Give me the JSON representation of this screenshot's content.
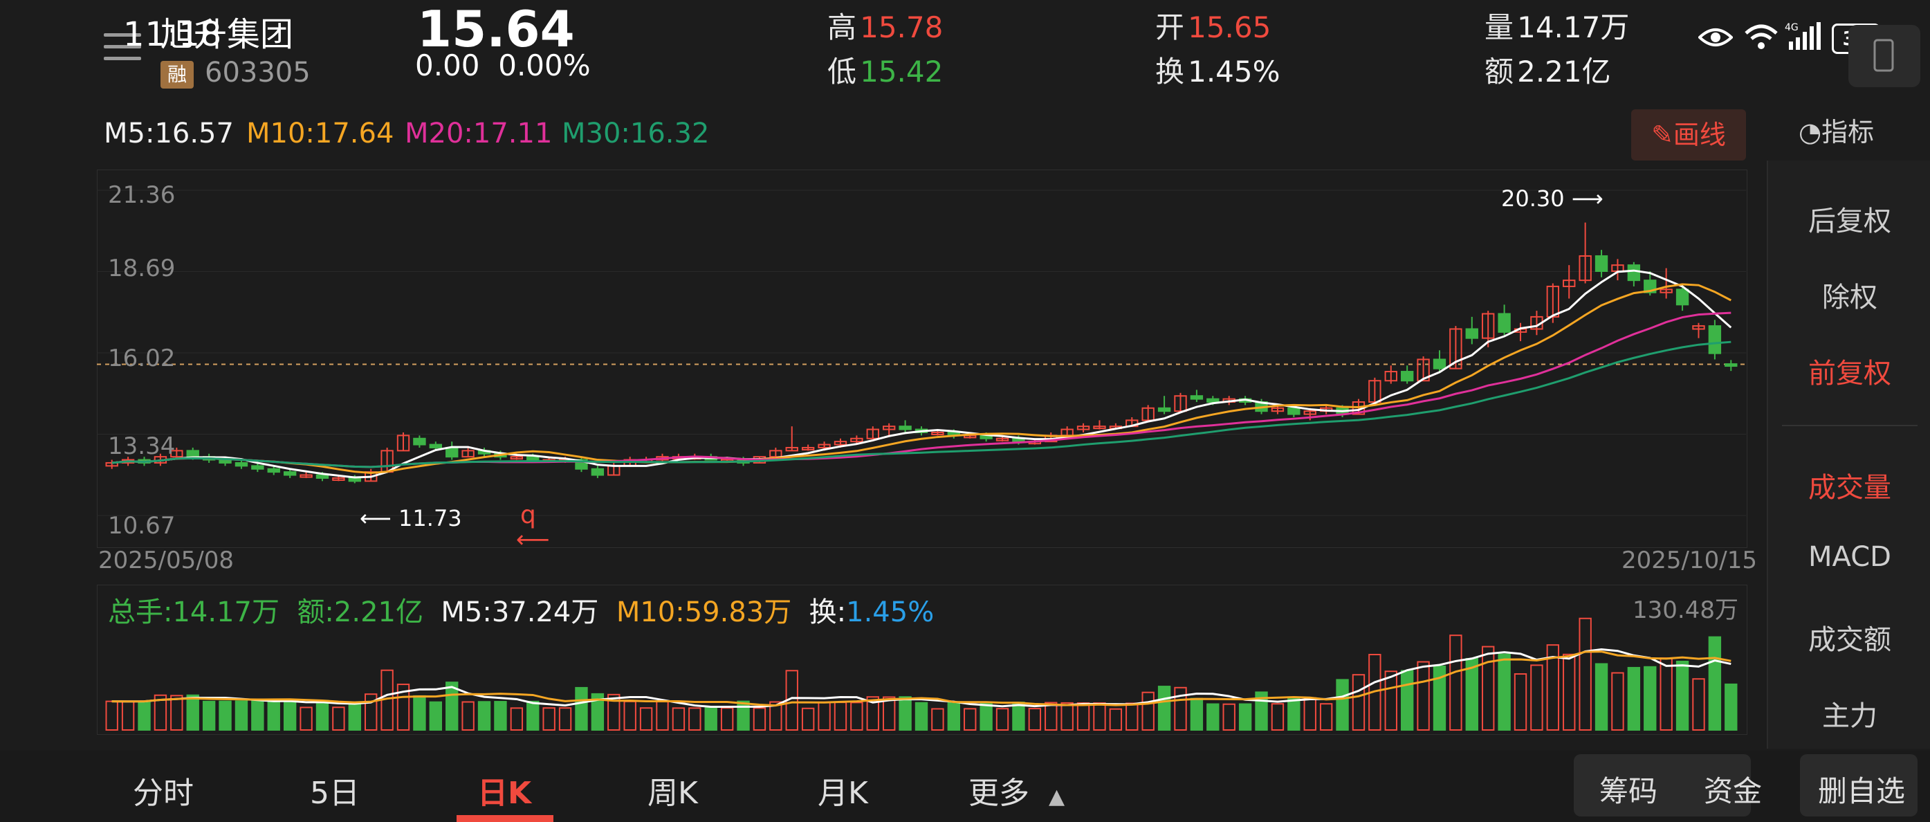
{
  "header": {
    "time": "11:18",
    "stock_name": "旭升集团",
    "rong_badge": "融",
    "code": "603305",
    "price": "15.64",
    "change": "0.00",
    "change_pct": "0.00%",
    "high_label": "高",
    "high": "15.78",
    "low_label": "低",
    "low": "15.42",
    "open_label": "开",
    "open": "15.65",
    "turnover_label": "换",
    "turnover": "1.45%",
    "volume_label": "量",
    "volume": "14.17万",
    "amount_label": "额",
    "amount": "2.21亿",
    "battery": "34"
  },
  "ma": {
    "m5": "M5:16.57",
    "m10": "M10:17.64",
    "m20": "M20:17.11",
    "m30": "M30:16.32"
  },
  "buttons": {
    "draw": "画线",
    "indicator": "指标"
  },
  "chart": {
    "y_ticks": [
      "21.36",
      "18.69",
      "16.02",
      "13.34",
      "10.67"
    ],
    "start_date": "2025/05/08",
    "end_date": "2025/10/15",
    "max_label": "20.30",
    "min_label": "11.73",
    "marker_q": "q"
  },
  "volume": {
    "total": "总手:14.17万",
    "amount": "额:2.21亿",
    "m5": "M5:37.24万",
    "m10": "M10:59.83万",
    "turnover_label": "换:",
    "turnover": "1.45%",
    "max_label": "130.48万"
  },
  "sidebar": {
    "items": [
      "后复权",
      "除权",
      "前复权",
      "成交量",
      "MACD",
      "成交额",
      "主力"
    ]
  },
  "tabs": {
    "items": [
      "分时",
      "5日",
      "日K",
      "周K",
      "月K",
      "更多"
    ],
    "chips": "筹码",
    "funds": "资金",
    "remove": "删自选"
  },
  "colors": {
    "up": "#f04a3e",
    "down": "#3db447",
    "ma5": "#ffffff",
    "ma10": "#f5a623",
    "ma20": "#e0309a",
    "ma30": "#1f9e6e"
  },
  "chart_data": {
    "type": "candlestick",
    "price_range": [
      10.67,
      21.36
    ],
    "volume_max": 130.48,
    "candles_approx": [
      [
        12.3,
        12.5,
        12.2,
        12.4
      ],
      [
        12.4,
        12.6,
        12.3,
        12.5
      ],
      [
        12.5,
        12.6,
        12.3,
        12.4
      ],
      [
        12.4,
        12.7,
        12.3,
        12.6
      ],
      [
        12.6,
        12.9,
        12.5,
        12.8
      ],
      [
        12.8,
        12.9,
        12.5,
        12.6
      ],
      [
        12.6,
        12.7,
        12.4,
        12.5
      ],
      [
        12.5,
        12.6,
        12.3,
        12.4
      ],
      [
        12.4,
        12.5,
        12.2,
        12.3
      ],
      [
        12.3,
        12.4,
        12.1,
        12.2
      ],
      [
        12.2,
        12.3,
        12.0,
        12.1
      ],
      [
        12.1,
        12.2,
        11.9,
        12.0
      ],
      [
        12.0,
        12.1,
        11.9,
        12.0
      ],
      [
        12.0,
        12.1,
        11.8,
        11.9
      ],
      [
        11.9,
        12.0,
        11.8,
        11.9
      ],
      [
        11.9,
        12.0,
        11.73,
        11.8
      ],
      [
        11.8,
        12.2,
        11.8,
        12.1
      ],
      [
        12.1,
        12.9,
        12.1,
        12.8
      ],
      [
        12.8,
        13.4,
        12.8,
        13.3
      ],
      [
        13.2,
        13.3,
        12.9,
        13.0
      ],
      [
        13.0,
        13.1,
        12.8,
        12.9
      ],
      [
        12.9,
        13.1,
        12.5,
        12.6
      ],
      [
        12.6,
        12.9,
        12.6,
        12.8
      ],
      [
        12.8,
        12.9,
        12.6,
        12.7
      ],
      [
        12.7,
        12.8,
        12.5,
        12.6
      ],
      [
        12.6,
        12.7,
        12.5,
        12.6
      ],
      [
        12.6,
        12.7,
        12.4,
        12.5
      ],
      [
        12.5,
        12.6,
        12.4,
        12.5
      ],
      [
        12.5,
        12.6,
        12.4,
        12.5
      ],
      [
        12.5,
        12.6,
        12.1,
        12.2
      ],
      [
        12.2,
        12.3,
        11.9,
        12.0
      ],
      [
        12.0,
        12.4,
        12.0,
        12.3
      ],
      [
        12.3,
        12.6,
        12.3,
        12.5
      ],
      [
        12.5,
        12.6,
        12.4,
        12.5
      ],
      [
        12.5,
        12.7,
        12.4,
        12.6
      ],
      [
        12.6,
        12.7,
        12.5,
        12.6
      ],
      [
        12.6,
        12.7,
        12.5,
        12.6
      ],
      [
        12.6,
        12.7,
        12.5,
        12.5
      ],
      [
        12.5,
        12.6,
        12.4,
        12.5
      ],
      [
        12.5,
        12.6,
        12.3,
        12.4
      ],
      [
        12.4,
        12.6,
        12.4,
        12.6
      ],
      [
        12.6,
        12.9,
        12.6,
        12.8
      ],
      [
        12.8,
        13.6,
        12.8,
        12.9
      ],
      [
        12.9,
        13.0,
        12.8,
        12.9
      ],
      [
        12.9,
        13.1,
        12.8,
        13.0
      ],
      [
        13.0,
        13.2,
        12.9,
        13.1
      ],
      [
        13.1,
        13.3,
        13.0,
        13.2
      ],
      [
        13.2,
        13.6,
        13.2,
        13.5
      ],
      [
        13.5,
        13.7,
        13.3,
        13.6
      ],
      [
        13.6,
        13.8,
        13.4,
        13.5
      ],
      [
        13.5,
        13.6,
        13.3,
        13.4
      ],
      [
        13.4,
        13.5,
        13.3,
        13.4
      ],
      [
        13.4,
        13.5,
        13.2,
        13.3
      ],
      [
        13.3,
        13.4,
        13.2,
        13.3
      ],
      [
        13.3,
        13.4,
        13.1,
        13.2
      ],
      [
        13.2,
        13.3,
        13.1,
        13.2
      ],
      [
        13.2,
        13.3,
        13.0,
        13.1
      ],
      [
        13.1,
        13.2,
        13.0,
        13.1
      ],
      [
        13.1,
        13.4,
        13.1,
        13.3
      ],
      [
        13.3,
        13.6,
        13.3,
        13.5
      ],
      [
        13.5,
        13.7,
        13.4,
        13.6
      ],
      [
        13.6,
        13.8,
        13.5,
        13.6
      ],
      [
        13.6,
        13.7,
        13.5,
        13.6
      ],
      [
        13.6,
        13.9,
        13.6,
        13.8
      ],
      [
        13.8,
        14.3,
        13.8,
        14.2
      ],
      [
        14.2,
        14.6,
        14.0,
        14.1
      ],
      [
        14.1,
        14.7,
        14.1,
        14.6
      ],
      [
        14.6,
        14.8,
        14.4,
        14.5
      ],
      [
        14.5,
        14.6,
        14.3,
        14.4
      ],
      [
        14.4,
        14.6,
        14.3,
        14.5
      ],
      [
        14.5,
        14.6,
        14.3,
        14.4
      ],
      [
        14.4,
        14.5,
        14.0,
        14.1
      ],
      [
        14.1,
        14.3,
        14.0,
        14.2
      ],
      [
        14.2,
        14.3,
        13.9,
        14.0
      ],
      [
        14.0,
        14.2,
        13.8,
        14.1
      ],
      [
        14.1,
        14.3,
        14.0,
        14.2
      ],
      [
        14.2,
        14.3,
        13.9,
        14.0
      ],
      [
        14.0,
        14.5,
        14.0,
        14.4
      ],
      [
        14.4,
        15.2,
        14.3,
        15.1
      ],
      [
        15.1,
        15.6,
        15.0,
        15.4
      ],
      [
        15.4,
        15.6,
        15.0,
        15.1
      ],
      [
        15.1,
        15.9,
        15.1,
        15.8
      ],
      [
        15.8,
        16.1,
        15.4,
        15.5
      ],
      [
        15.5,
        16.9,
        15.5,
        16.8
      ],
      [
        16.8,
        17.2,
        16.3,
        16.5
      ],
      [
        16.5,
        17.4,
        16.2,
        17.3
      ],
      [
        17.3,
        17.6,
        16.6,
        16.7
      ],
      [
        16.7,
        17.0,
        16.4,
        16.8
      ],
      [
        16.8,
        17.4,
        16.6,
        17.2
      ],
      [
        17.2,
        18.3,
        17.0,
        18.2
      ],
      [
        18.2,
        18.9,
        17.8,
        18.4
      ],
      [
        18.4,
        20.3,
        18.3,
        19.2
      ],
      [
        19.2,
        19.4,
        18.5,
        18.7
      ],
      [
        18.7,
        19.1,
        18.4,
        18.9
      ],
      [
        18.9,
        19.0,
        18.2,
        18.4
      ],
      [
        18.4,
        18.7,
        17.9,
        18.0
      ],
      [
        18.0,
        18.8,
        17.8,
        18.1
      ],
      [
        18.1,
        18.3,
        17.4,
        17.6
      ],
      [
        16.8,
        17.0,
        16.5,
        16.9
      ],
      [
        16.9,
        17.1,
        15.8,
        16.0
      ],
      [
        15.65,
        15.78,
        15.42,
        15.64
      ]
    ]
  }
}
